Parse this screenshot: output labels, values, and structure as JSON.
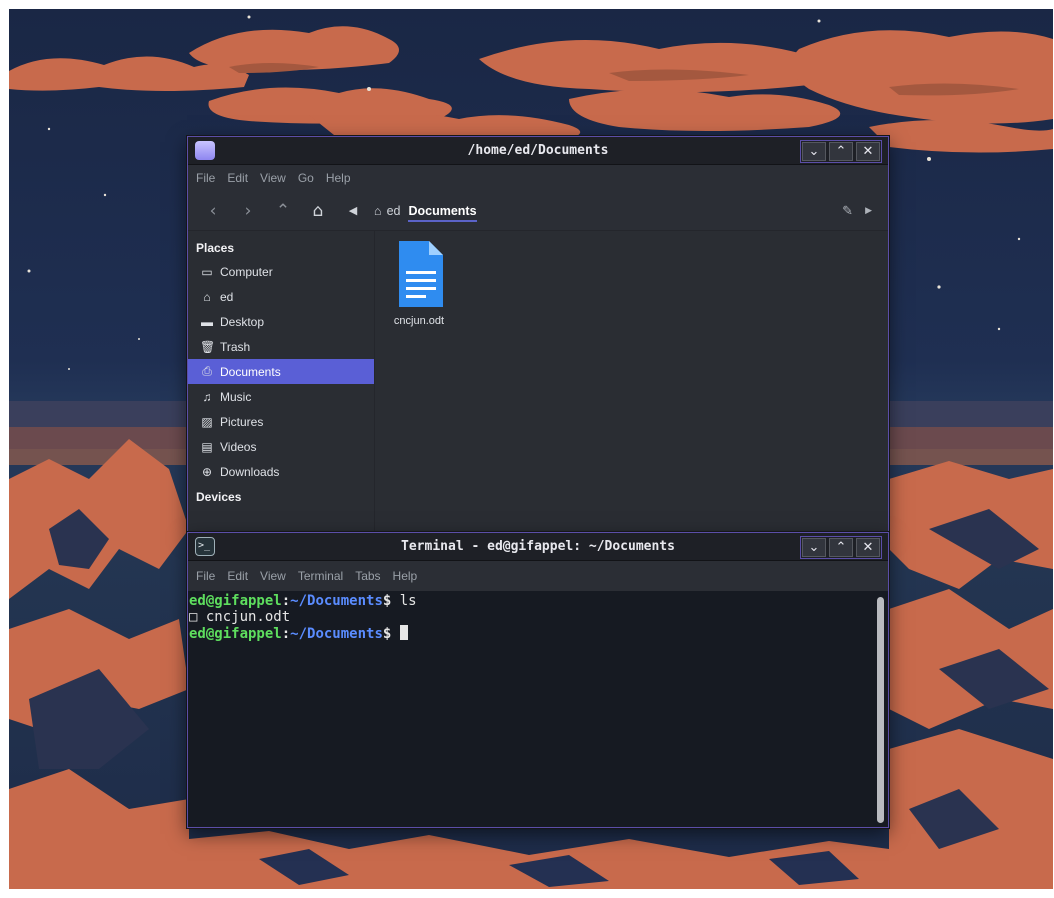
{
  "file_manager": {
    "title": "/home/ed/Documents",
    "menu": [
      "File",
      "Edit",
      "View",
      "Go",
      "Help"
    ],
    "breadcrumbs": [
      "ed",
      "Documents"
    ],
    "places_header": "Places",
    "places": [
      {
        "label": "Computer",
        "icon": "computer-icon",
        "glyph": "▭"
      },
      {
        "label": "ed",
        "icon": "home-icon",
        "glyph": "⌂"
      },
      {
        "label": "Desktop",
        "icon": "desktop-icon",
        "glyph": "▬"
      },
      {
        "label": "Trash",
        "icon": "trash-icon",
        "glyph": "🗑"
      },
      {
        "label": "Documents",
        "icon": "documents-icon",
        "glyph": "⎙",
        "selected": true
      },
      {
        "label": "Music",
        "icon": "music-icon",
        "glyph": "♫"
      },
      {
        "label": "Pictures",
        "icon": "pictures-icon",
        "glyph": "▨"
      },
      {
        "label": "Videos",
        "icon": "videos-icon",
        "glyph": "▤"
      },
      {
        "label": "Downloads",
        "icon": "downloads-icon",
        "glyph": "⊕"
      }
    ],
    "devices_header": "Devices",
    "files": [
      {
        "name": "cncjun.odt",
        "icon": "document-file-icon"
      }
    ]
  },
  "terminal": {
    "title": "Terminal - ed@gifappel: ~/Documents",
    "menu": [
      "File",
      "Edit",
      "View",
      "Terminal",
      "Tabs",
      "Help"
    ],
    "lines": [
      {
        "user": "ed@gifappel",
        "sep": ":",
        "path": "~/Documents",
        "sign": "$",
        "cmd": " ls"
      },
      {
        "output": "□ cncjun.odt"
      },
      {
        "user": "ed@gifappel",
        "sep": ":",
        "path": "~/Documents",
        "sign": "$",
        "cmd": " "
      }
    ]
  },
  "window_controls": {
    "minimize": "⌄",
    "maximize": "⌃",
    "close": "✕"
  },
  "colors": {
    "accent": "#5a5fd6",
    "window_border": "#5b4ea8",
    "prompt_user": "#5ede5e",
    "prompt_path": "#5a8cff",
    "wallpaper_sky": "#1f2f52",
    "wallpaper_orange": "#c86a4c"
  }
}
